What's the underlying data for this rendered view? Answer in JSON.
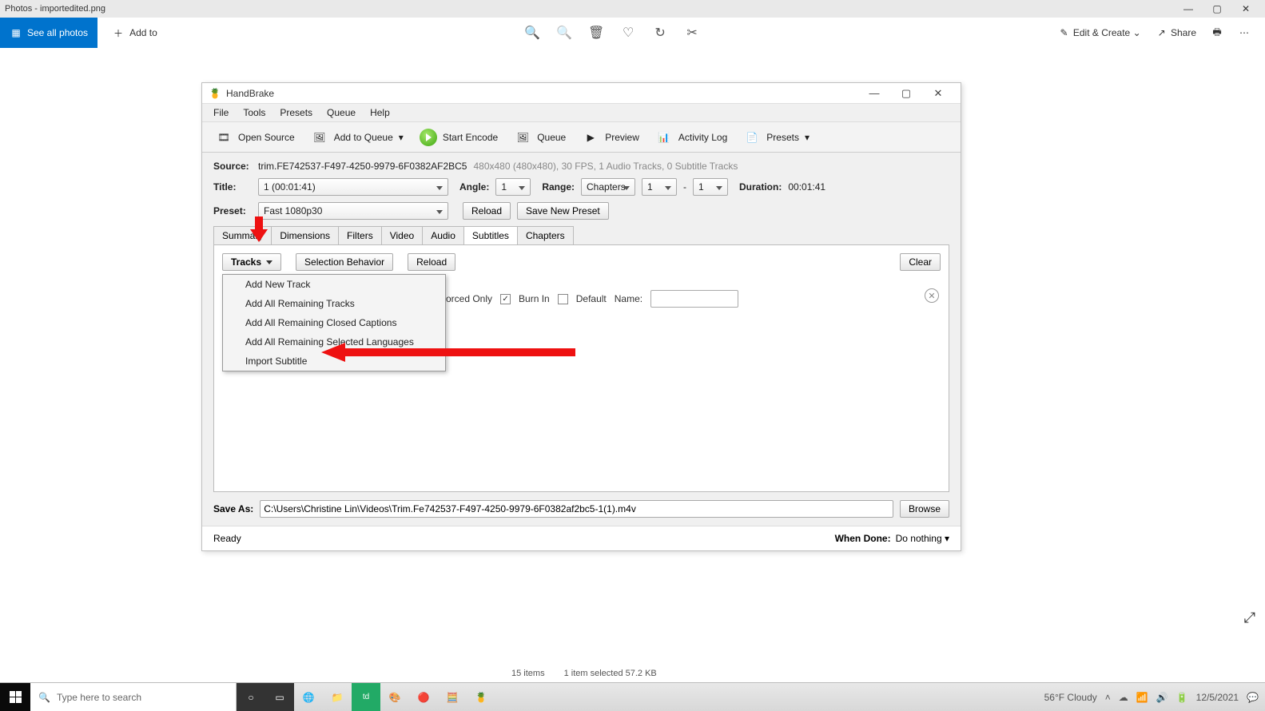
{
  "photos": {
    "title": "Photos - importedited.png",
    "see_all": "See all photos",
    "add_to": "Add to",
    "edit_create": "Edit & Create",
    "share": "Share"
  },
  "hb": {
    "title": "HandBrake",
    "menus": [
      "File",
      "Tools",
      "Presets",
      "Queue",
      "Help"
    ],
    "toolbar": {
      "open_source": "Open Source",
      "add_queue": "Add to Queue",
      "start_encode": "Start Encode",
      "queue": "Queue",
      "preview": "Preview",
      "activity": "Activity Log",
      "presets": "Presets"
    },
    "source_label": "Source:",
    "source_value": "trim.FE742537-F497-4250-9979-6F0382AF2BC5",
    "source_info": "480x480 (480x480), 30 FPS, 1 Audio Tracks, 0 Subtitle Tracks",
    "title_label": "Title:",
    "title_value": "1  (00:01:41)",
    "angle_label": "Angle:",
    "angle_value": "1",
    "range_label": "Range:",
    "range_type": "Chapters",
    "range_from": "1",
    "range_to": "1",
    "range_dash": "-",
    "duration_label": "Duration:",
    "duration_value": "00:01:41",
    "preset_label": "Preset:",
    "preset_value": "Fast 1080p30",
    "reload": "Reload",
    "save_preset": "Save New Preset",
    "tabs": [
      "Summary",
      "Dimensions",
      "Filters",
      "Video",
      "Audio",
      "Subtitles",
      "Chapters"
    ],
    "active_tab": 5,
    "tracks_btn": "Tracks",
    "sel_behavior": "Selection Behavior",
    "clear": "Clear",
    "tracks_menu": [
      "Add New Track",
      "Add All Remaining Tracks",
      "Add All Remaining Closed Captions",
      "Add All Remaining Selected Languages",
      "Import Subtitle"
    ],
    "sub_forced": "orced Only",
    "sub_burn": "Burn In",
    "sub_default": "Default",
    "sub_name": "Name:",
    "saveas_label": "Save As:",
    "saveas_value": "C:\\Users\\Christine Lin\\Videos\\Trim.Fe742537-F497-4250-9979-6F0382af2bc5-1(1).m4v",
    "browse": "Browse",
    "ready": "Ready",
    "when_done_label": "When Done:",
    "when_done_value": "Do nothing"
  },
  "taskbar": {
    "search_placeholder": "Type here to search",
    "items": "15 items",
    "selected": "1 item selected  57.2 KB",
    "weather": "56°F  Cloudy",
    "date": "12/5/2021"
  }
}
